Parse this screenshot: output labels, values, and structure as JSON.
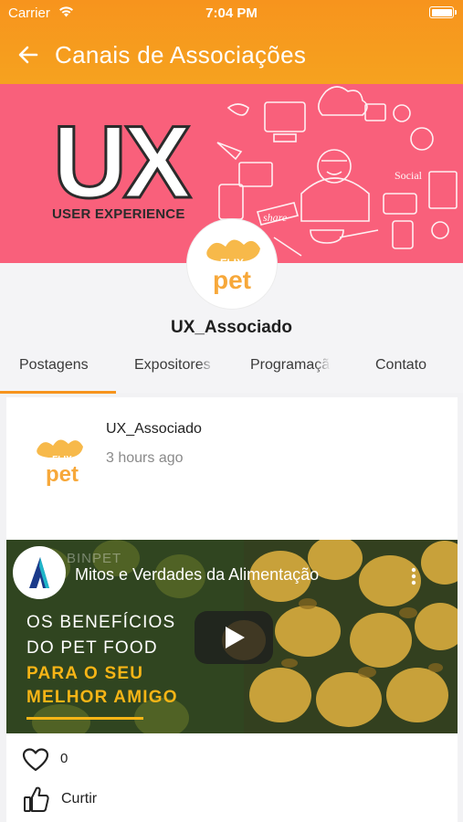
{
  "status_bar": {
    "carrier": "Carrier",
    "time": "7:04 PM"
  },
  "header": {
    "title": "Canais de Associações"
  },
  "banner": {
    "logo_text": "UX",
    "caption": "USER EXPERIENCE"
  },
  "channel": {
    "name": "UX_Associado",
    "avatar_text": {
      "top": "FLIX",
      "bottom": "pet"
    }
  },
  "tabs": [
    "Postagens",
    "Expositores",
    "Programação",
    "Contato"
  ],
  "active_tab": "Postagens",
  "post": {
    "author": "UX_Associado",
    "time": "3 hours ago",
    "video": {
      "channel_brand": "BINPET",
      "title": "Mitos e Verdades da Alimentação",
      "lines": [
        "OS BENEFÍCIOS",
        "DO PET FOOD",
        "PARA O SEU",
        "MELHOR AMIGO"
      ]
    },
    "likes": "0",
    "like_label": "Curtir"
  },
  "colors": {
    "header": "#f7941d",
    "banner": "#f9607b",
    "accent": "#f7941d",
    "video_yellow": "#f7b516"
  }
}
